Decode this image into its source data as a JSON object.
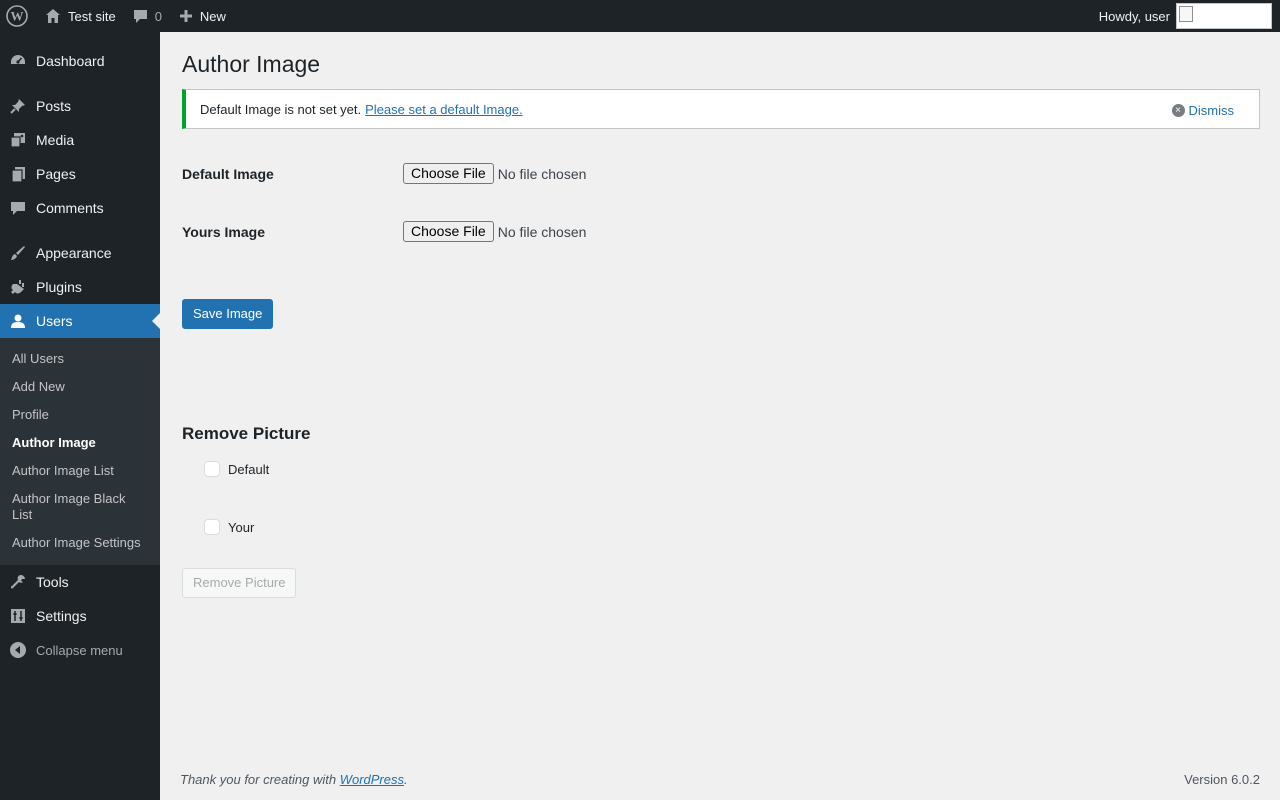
{
  "adminbar": {
    "site_name": "Test site",
    "comments_count": "0",
    "new_label": "New",
    "howdy": "Howdy, user"
  },
  "menu": {
    "dashboard": "Dashboard",
    "posts": "Posts",
    "media": "Media",
    "pages": "Pages",
    "comments": "Comments",
    "appearance": "Appearance",
    "plugins": "Plugins",
    "users": "Users",
    "users_submenu": [
      "All Users",
      "Add New",
      "Profile",
      "Author Image",
      "Author Image List",
      "Author Image Black List",
      "Author Image Settings"
    ],
    "tools": "Tools",
    "settings": "Settings",
    "collapse": "Collapse menu"
  },
  "page": {
    "title": "Author Image",
    "notice_text": "Default Image is not set yet.",
    "notice_link": "Please set a default Image.",
    "dismiss": "Dismiss",
    "default_image_label": "Default Image",
    "yours_image_label": "Yours Image",
    "choose_file": "Choose File",
    "no_file": "No file chosen",
    "save_button": "Save Image",
    "remove_heading": "Remove Picture",
    "check_default": "Default",
    "check_your": "Your",
    "remove_button": "Remove Picture"
  },
  "footer": {
    "thanks_prefix": "Thank you for creating with",
    "wordpress_link": "WordPress",
    "thanks_suffix": ".",
    "version": "Version 6.0.2"
  },
  "colors": {
    "accent": "#2271b1",
    "notice_success": "#00a32a",
    "menu_bg": "#1d2327"
  }
}
